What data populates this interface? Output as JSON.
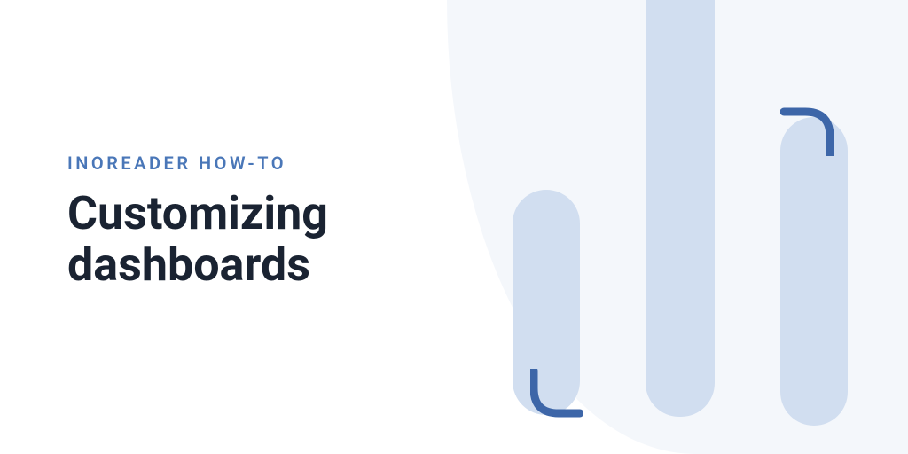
{
  "eyebrow": "INOREADER HOW-TO",
  "headline_line1": "Customizing",
  "headline_line2": "dashboards",
  "colors": {
    "background": "#ffffff",
    "wave": "#f4f7fb",
    "eyebrow": "#4a77b8",
    "headline": "#1a2332",
    "bars": "#d1def0",
    "accent": "#3d66a8"
  }
}
